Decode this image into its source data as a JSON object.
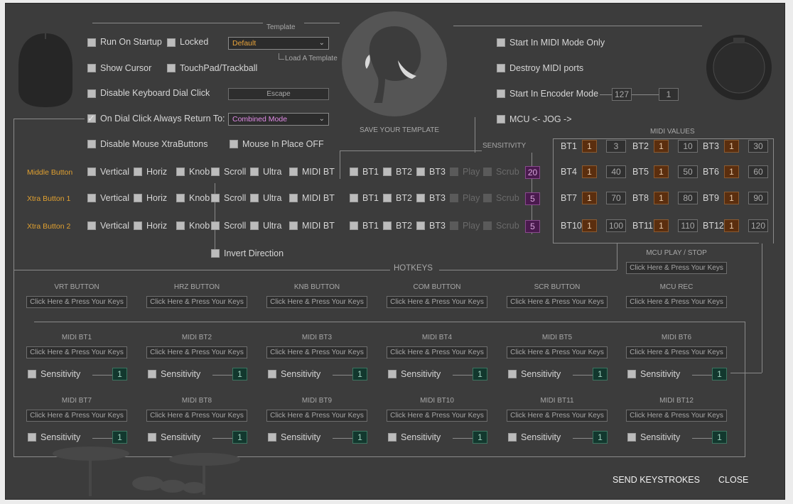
{
  "template": {
    "title": "Template",
    "selected": "Default",
    "load_label": "Load A Template",
    "save_label": "SAVE YOUR TEMPLATE"
  },
  "options_left": [
    {
      "label": "Run On Startup",
      "checked": false
    },
    {
      "label": "Locked",
      "checked": false
    },
    {
      "label": "Show Cursor",
      "checked": false
    },
    {
      "label": "TouchPad/Trackball",
      "checked": false
    },
    {
      "label": "Disable Keyboard Dial Click",
      "checked": false
    },
    {
      "label": "On Dial Click Always Return To:",
      "checked": true
    },
    {
      "label": "Disable Mouse XtraButtons",
      "checked": false
    },
    {
      "label": "Mouse In Place OFF",
      "checked": false
    }
  ],
  "escape_field": "Escape",
  "return_mode": "Combined Mode",
  "options_right": [
    {
      "label": "Start In MIDI Mode Only",
      "checked": false
    },
    {
      "label": "Destroy MIDI ports",
      "checked": false
    },
    {
      "label": "Start In Encoder Mode",
      "checked": false
    },
    {
      "label": "MCU <- JOG ->",
      "checked": false
    }
  ],
  "encoder_values": [
    "127",
    "1"
  ],
  "sensitivity_title": "SENSITIVITY",
  "midi_values_title": "MIDI  VALUES",
  "button_rows": [
    {
      "label": "Middle Button",
      "sensitivity": "20",
      "checks": {
        "Vertical": false,
        "Horiz": false,
        "Knob": false,
        "Scroll": true,
        "Ultra": false,
        "MIDI BT": false,
        "BT1": true,
        "BT2": false,
        "BT3": false,
        "Play": false,
        "Scrub": true
      }
    },
    {
      "label": "Xtra Button 1",
      "sensitivity": "5",
      "checks": {
        "Vertical": false,
        "Horiz": true,
        "Knob": false,
        "Scroll": false,
        "Ultra": false,
        "MIDI BT": false,
        "BT1": true,
        "BT2": false,
        "BT3": false,
        "Play": false,
        "Scrub": false
      }
    },
    {
      "label": "Xtra Button 2",
      "sensitivity": "5",
      "checks": {
        "Vertical": true,
        "Horiz": false,
        "Knob": false,
        "Scroll": false,
        "Ultra": false,
        "MIDI BT": false,
        "BT1": true,
        "BT2": false,
        "BT3": false,
        "Play": false,
        "Scrub": false
      }
    }
  ],
  "check_labels": [
    "Vertical",
    "Horiz",
    "Knob",
    "Scroll",
    "Ultra",
    "MIDI BT",
    "BT1",
    "BT2",
    "BT3",
    "Play",
    "Scrub"
  ],
  "invert_direction": {
    "label": "Invert Direction",
    "checked": false
  },
  "midi_values": [
    {
      "name": "BT1",
      "ch": "1",
      "val": "3"
    },
    {
      "name": "BT2",
      "ch": "1",
      "val": "10"
    },
    {
      "name": "BT3",
      "ch": "1",
      "val": "30"
    },
    {
      "name": "BT4",
      "ch": "1",
      "val": "40"
    },
    {
      "name": "BT5",
      "ch": "1",
      "val": "50"
    },
    {
      "name": "BT6",
      "ch": "1",
      "val": "60"
    },
    {
      "name": "BT7",
      "ch": "1",
      "val": "70"
    },
    {
      "name": "BT8",
      "ch": "1",
      "val": "80"
    },
    {
      "name": "BT9",
      "ch": "1",
      "val": "90"
    },
    {
      "name": "BT10",
      "ch": "1",
      "val": "100"
    },
    {
      "name": "BT11",
      "ch": "1",
      "val": "110"
    },
    {
      "name": "BT12",
      "ch": "1",
      "val": "120"
    }
  ],
  "hotkeys_title": "HOTKEYS",
  "hotkey_placeholder": "Click Here & Press Your Keys",
  "hotkey_buttons": [
    "VRT BUTTON",
    "HRZ BUTTON",
    "KNB BUTTON",
    "COM BUTTON",
    "SCR BUTTON"
  ],
  "mcu_hotkeys": [
    "MCU PLAY / STOP",
    "MCU REC"
  ],
  "midi_hotkeys": [
    {
      "name": "MIDI BT1",
      "sens_label": "Sensitivity",
      "checked": true,
      "value": "1"
    },
    {
      "name": "MIDI BT2",
      "sens_label": "Sensitivity",
      "checked": true,
      "value": "1"
    },
    {
      "name": "MIDI BT3",
      "sens_label": "Sensitivity",
      "checked": true,
      "value": "1"
    },
    {
      "name": "MIDI BT4",
      "sens_label": "Sensitivity",
      "checked": true,
      "value": "1"
    },
    {
      "name": "MIDI BT5",
      "sens_label": "Sensitivity",
      "checked": true,
      "value": "1"
    },
    {
      "name": "MIDI BT6",
      "sens_label": "Sensitivity",
      "checked": true,
      "value": "1"
    },
    {
      "name": "MIDI BT7",
      "sens_label": "Sensitivity",
      "checked": true,
      "value": "1"
    },
    {
      "name": "MIDI BT8",
      "sens_label": "Sensitivity",
      "checked": true,
      "value": "1"
    },
    {
      "name": "MIDI BT9",
      "sens_label": "Sensitivity",
      "checked": true,
      "value": "1"
    },
    {
      "name": "MIDI BT10",
      "sens_label": "Sensitivity",
      "checked": true,
      "value": "1"
    },
    {
      "name": "MIDI BT11",
      "sens_label": "Sensitivity",
      "checked": true,
      "value": "1"
    },
    {
      "name": "MIDI BT12",
      "sens_label": "Sensitivity",
      "checked": true,
      "value": "1"
    }
  ],
  "footer": {
    "send_label": "SEND KEYSTROKES",
    "close_label": "CLOSE"
  },
  "colors": {
    "panel": "#3c3c3c",
    "accent_orange": "#e0a030",
    "channel_box": "#5b2e0e",
    "sensitivity_box": "#4a1a4e",
    "midi_sens_box": "#12382e"
  }
}
